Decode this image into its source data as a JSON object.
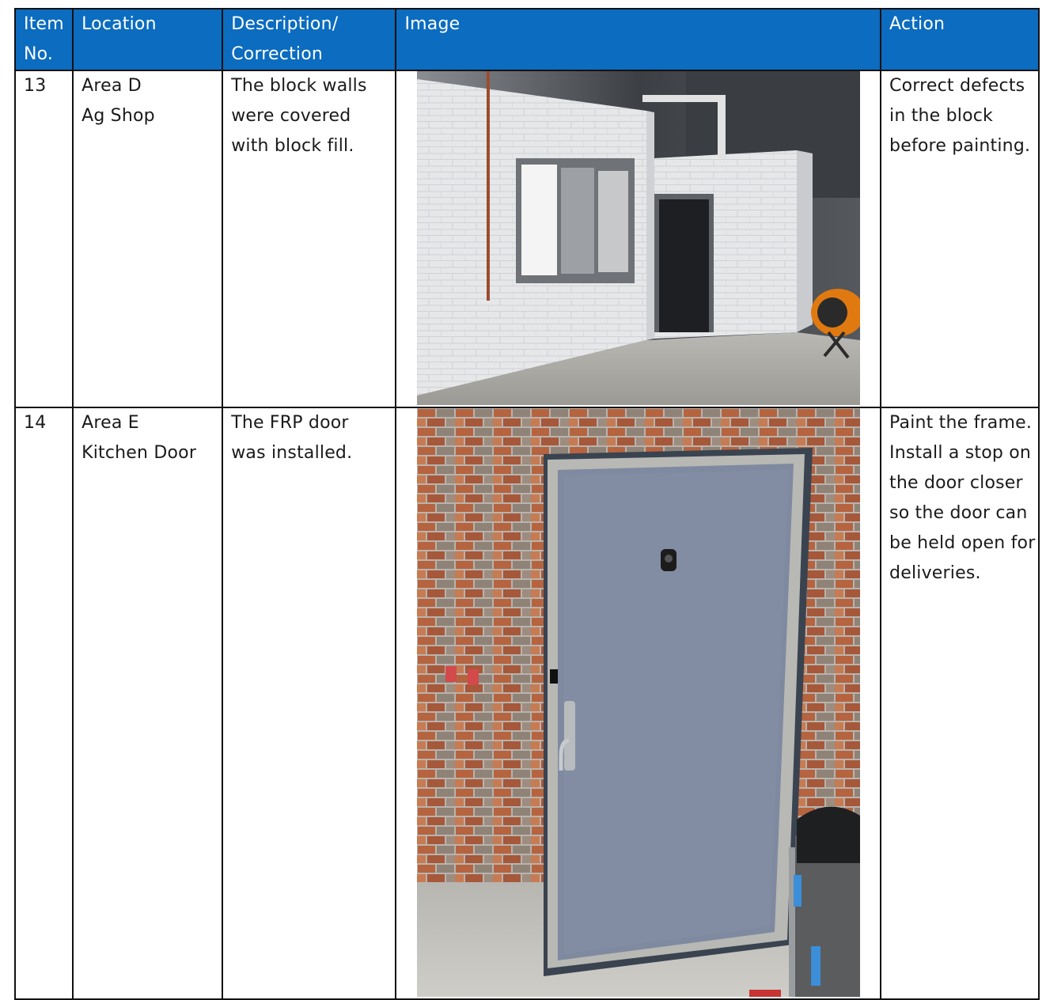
{
  "headers": {
    "item": [
      "Item",
      "No."
    ],
    "location": "Location",
    "description": [
      "Description/",
      "Correction"
    ],
    "image": "Image",
    "action": "Action"
  },
  "rows": [
    {
      "no": "13",
      "location": [
        "Area D",
        "Ag Shop"
      ],
      "description": [
        "The block walls",
        "were covered",
        "with block fill."
      ],
      "action": [
        "Correct defects",
        "in the block",
        "before painting."
      ]
    },
    {
      "no": "14",
      "location": [
        "Area E",
        "Kitchen Door"
      ],
      "description": [
        "The FRP door",
        "was installed."
      ],
      "action": [
        "Paint the frame.",
        "Install a stop on",
        "the door closer",
        "so the door can",
        "be held open for",
        "deliveries."
      ]
    }
  ]
}
